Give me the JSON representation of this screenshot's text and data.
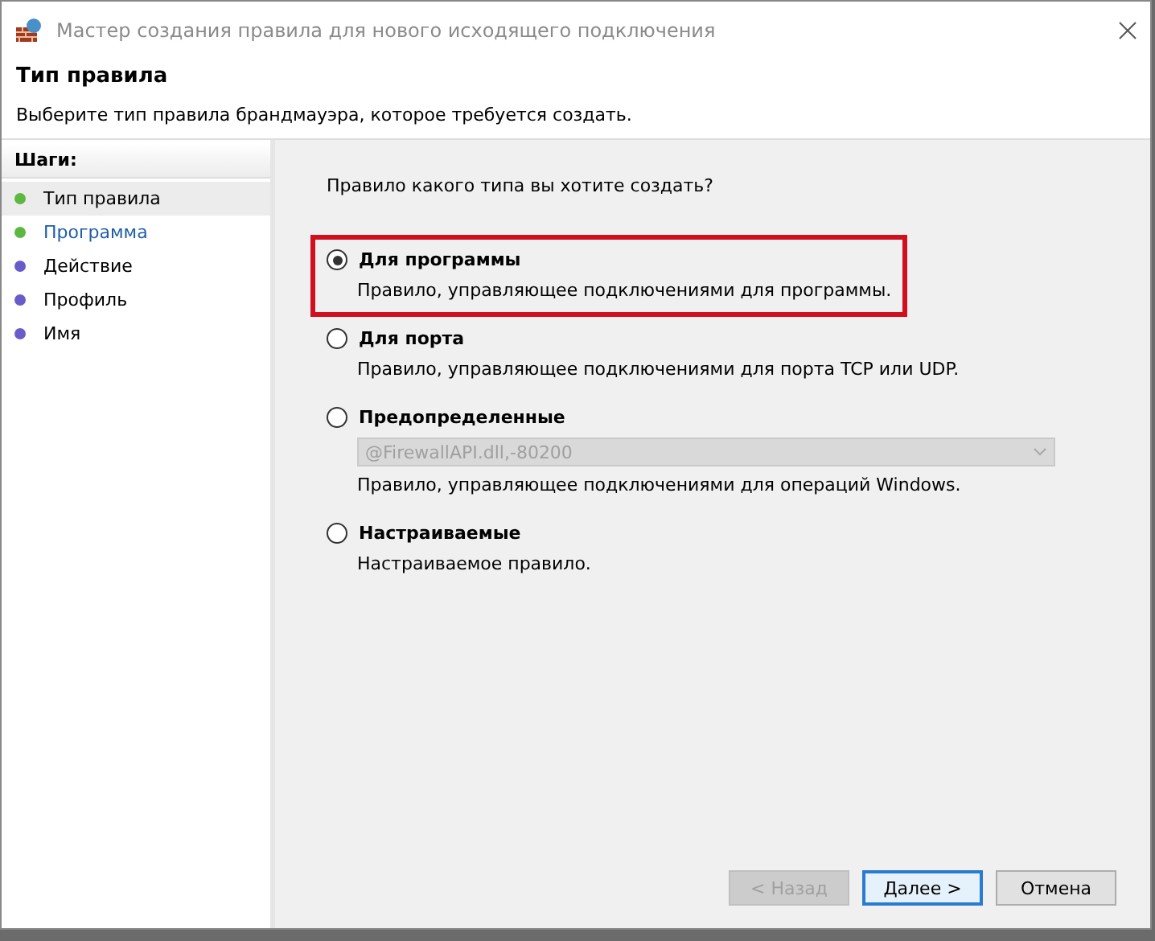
{
  "window": {
    "title": "Мастер создания правила для нового исходящего подключения"
  },
  "header": {
    "title": "Тип правила",
    "subtitle": "Выберите тип правила брандмауэра, которое требуется создать."
  },
  "steps": {
    "title": "Шаги:",
    "items": [
      {
        "label": "Тип правила",
        "selected": true,
        "hover": false,
        "color": "#5cb840"
      },
      {
        "label": "Программа",
        "selected": false,
        "hover": true,
        "color": "#5cb840"
      },
      {
        "label": "Действие",
        "selected": false,
        "hover": false,
        "color": "#6a5cc8"
      },
      {
        "label": "Профиль",
        "selected": false,
        "hover": false,
        "color": "#6a5cc8"
      },
      {
        "label": "Имя",
        "selected": false,
        "hover": false,
        "color": "#6a5cc8"
      }
    ]
  },
  "question": "Правило какого типа вы хотите создать?",
  "options": [
    {
      "label": "Для программы",
      "description": "Правило, управляющее подключениями для программы.",
      "selected": true,
      "highlighted": true
    },
    {
      "label": "Для порта",
      "description": "Правило, управляющее подключениями для порта TCP или UDP.",
      "selected": false,
      "highlighted": false
    },
    {
      "label": "Предопределенные",
      "dropdown": {
        "value": "@FirewallAPI.dll,-80200",
        "disabled": true
      },
      "description": "Правило, управляющее подключениями для операций Windows.",
      "selected": false,
      "highlighted": false
    },
    {
      "label": "Настраиваемые",
      "description": "Настраиваемое правило.",
      "selected": false,
      "highlighted": false
    }
  ],
  "buttons": [
    {
      "label": "< Назад",
      "disabled": true,
      "default": false
    },
    {
      "label": "Далее >",
      "disabled": false,
      "default": true
    },
    {
      "label": "Отмена",
      "disabled": false,
      "default": false
    }
  ]
}
